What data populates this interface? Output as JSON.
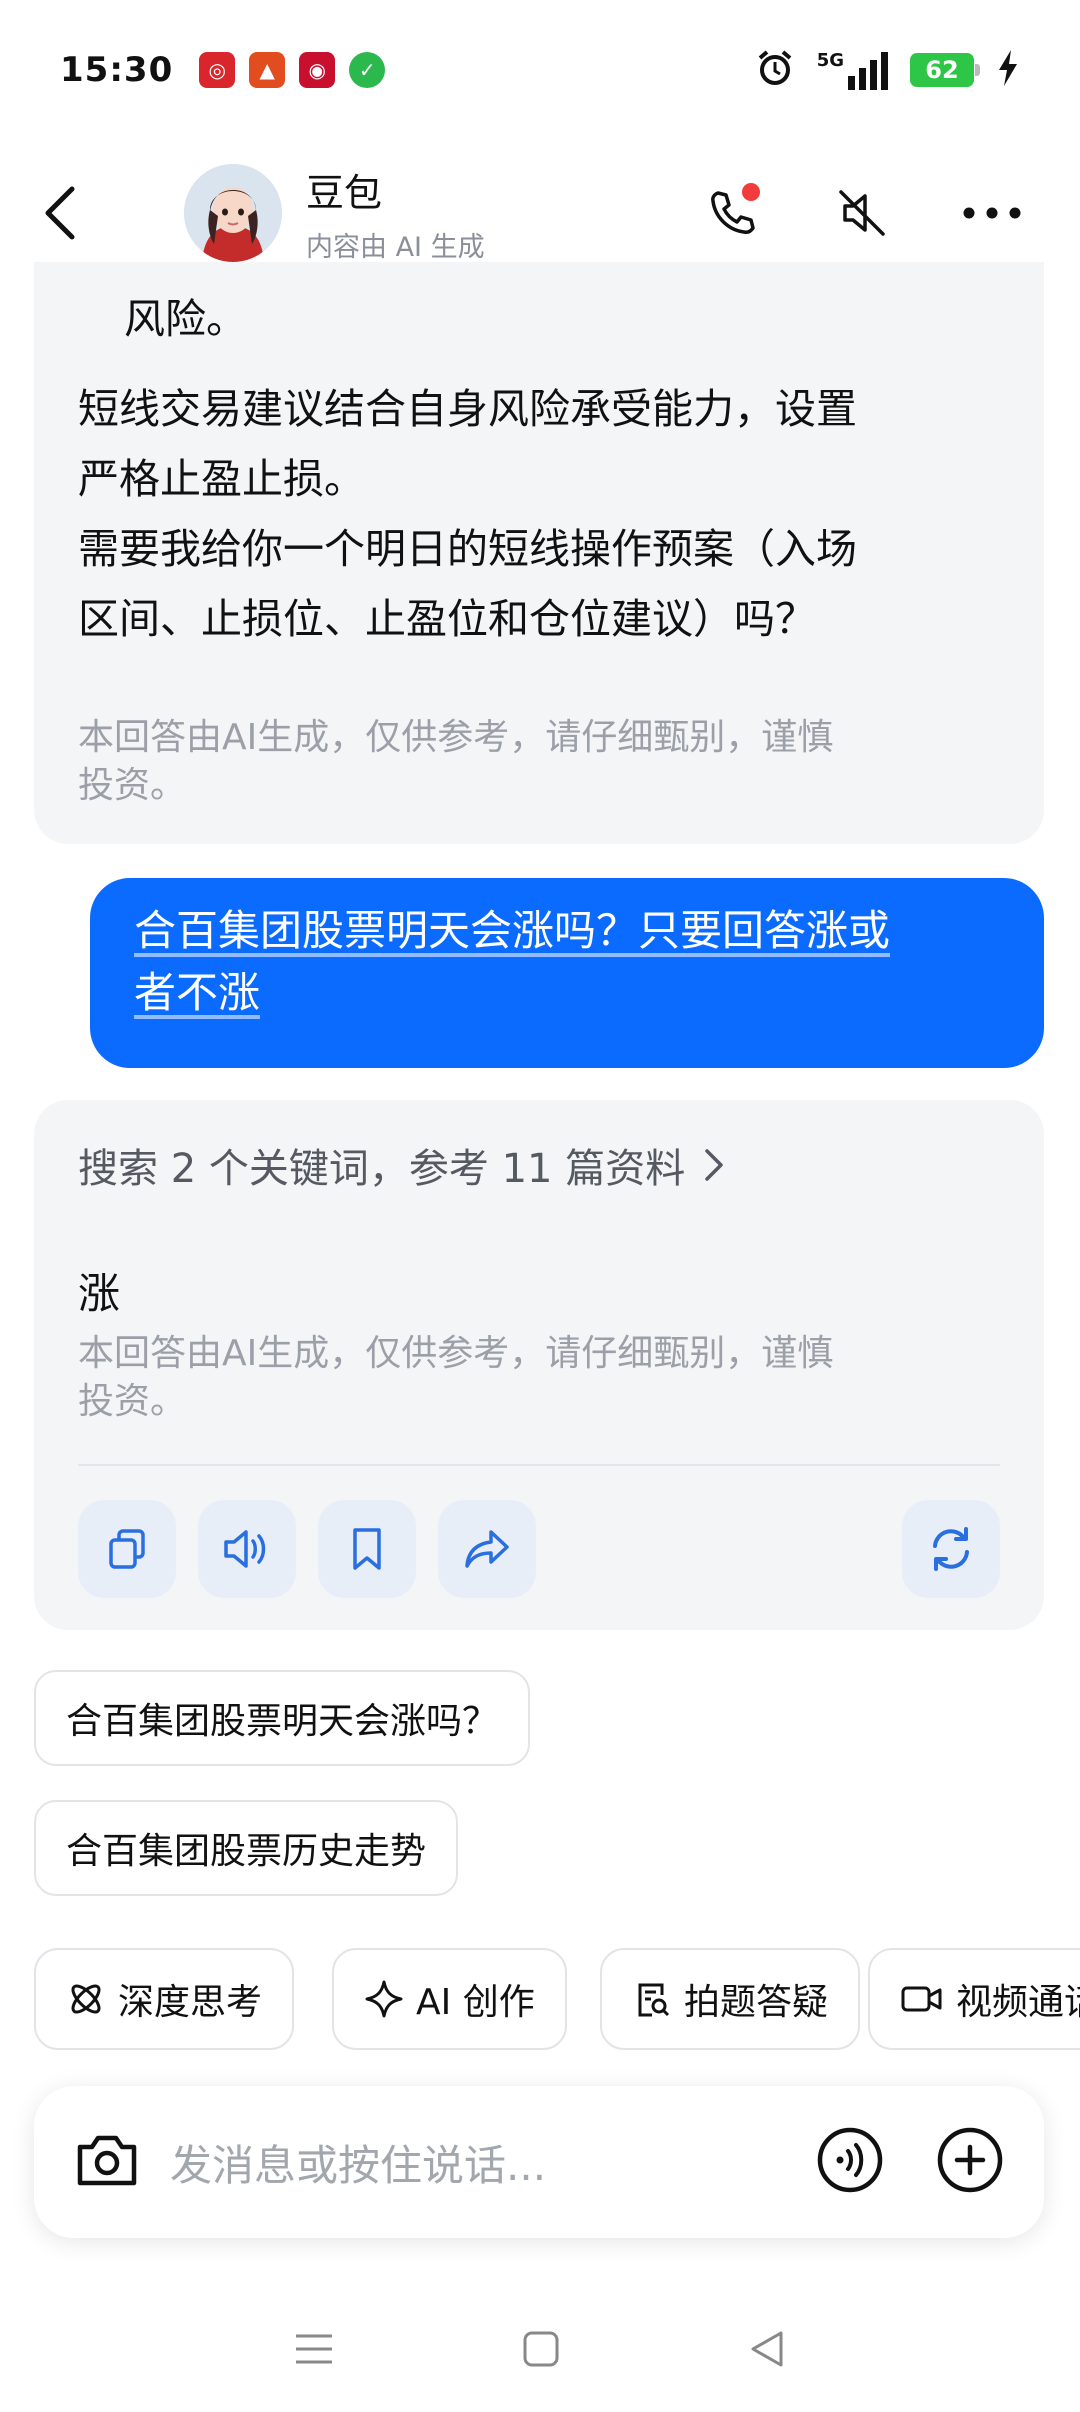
{
  "status_bar": {
    "time": "15:30",
    "network": "5G",
    "battery": "62",
    "app_icons": [
      "bank-app-icon",
      "cake-app-icon",
      "bank-of-china-icon",
      "shield-icon"
    ]
  },
  "header": {
    "bot_name": "豆包",
    "subtitle": "内容由 AI 生成"
  },
  "chat": {
    "prev_answer": {
      "line_tail": "风险。",
      "line1": "短线交易建议结合自身风险承受能力，设置",
      "line2": "严格止盈止损。",
      "line3": "需要我给你一个明日的短线操作预案（入场",
      "line4": "区间、止损位、止盈位和仓位建议）吗？",
      "disclaimer_line1": "本回答由AI生成，仅供参考，请仔细甄别，谨慎",
      "disclaimer_line2": "投资。"
    },
    "user_message": {
      "line1": "合百集团股票明天会涨吗？只要回答涨或",
      "line2": "者不涨"
    },
    "answer": {
      "search_summary": "搜索 2 个关键词，参考 11 篇资料",
      "text": "涨",
      "disclaimer_line1": "本回答由AI生成，仅供参考，请仔细甄别，谨慎",
      "disclaimer_line2": "投资。"
    }
  },
  "suggestions": [
    "合百集团股票明天会涨吗？",
    "合百集团股票历史走势"
  ],
  "tools": [
    "深度思考",
    "AI 创作",
    "拍题答疑",
    "视频通话"
  ],
  "input": {
    "placeholder": "发消息或按住说话..."
  },
  "colors": {
    "accent": "#0c6bff",
    "bubble_bg": "#f4f5f7",
    "action_bg": "#e8eef8",
    "icon_blue": "#2a6fe0"
  }
}
